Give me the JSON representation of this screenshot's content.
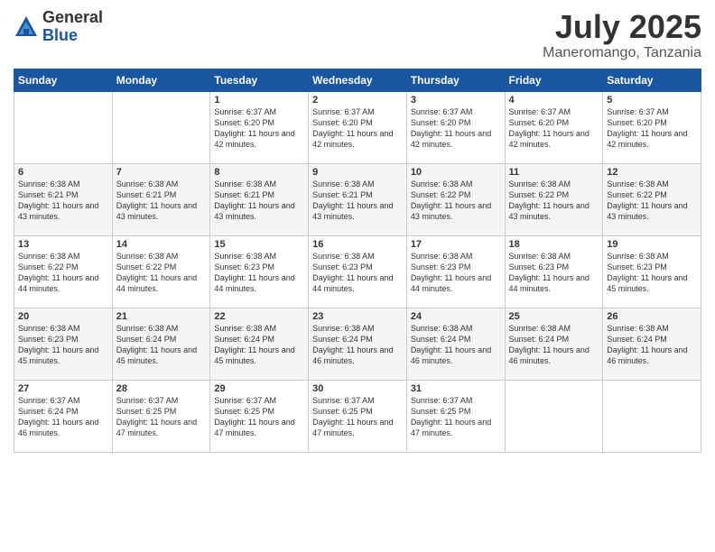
{
  "logo": {
    "general": "General",
    "blue": "Blue"
  },
  "header": {
    "month": "July 2025",
    "location": "Maneromango, Tanzania"
  },
  "weekdays": [
    "Sunday",
    "Monday",
    "Tuesday",
    "Wednesday",
    "Thursday",
    "Friday",
    "Saturday"
  ],
  "weeks": [
    [
      {
        "day": "",
        "info": ""
      },
      {
        "day": "",
        "info": ""
      },
      {
        "day": "1",
        "info": "Sunrise: 6:37 AM\nSunset: 6:20 PM\nDaylight: 11 hours and 42 minutes."
      },
      {
        "day": "2",
        "info": "Sunrise: 6:37 AM\nSunset: 6:20 PM\nDaylight: 11 hours and 42 minutes."
      },
      {
        "day": "3",
        "info": "Sunrise: 6:37 AM\nSunset: 6:20 PM\nDaylight: 11 hours and 42 minutes."
      },
      {
        "day": "4",
        "info": "Sunrise: 6:37 AM\nSunset: 6:20 PM\nDaylight: 11 hours and 42 minutes."
      },
      {
        "day": "5",
        "info": "Sunrise: 6:37 AM\nSunset: 6:20 PM\nDaylight: 11 hours and 42 minutes."
      }
    ],
    [
      {
        "day": "6",
        "info": "Sunrise: 6:38 AM\nSunset: 6:21 PM\nDaylight: 11 hours and 43 minutes."
      },
      {
        "day": "7",
        "info": "Sunrise: 6:38 AM\nSunset: 6:21 PM\nDaylight: 11 hours and 43 minutes."
      },
      {
        "day": "8",
        "info": "Sunrise: 6:38 AM\nSunset: 6:21 PM\nDaylight: 11 hours and 43 minutes."
      },
      {
        "day": "9",
        "info": "Sunrise: 6:38 AM\nSunset: 6:21 PM\nDaylight: 11 hours and 43 minutes."
      },
      {
        "day": "10",
        "info": "Sunrise: 6:38 AM\nSunset: 6:22 PM\nDaylight: 11 hours and 43 minutes."
      },
      {
        "day": "11",
        "info": "Sunrise: 6:38 AM\nSunset: 6:22 PM\nDaylight: 11 hours and 43 minutes."
      },
      {
        "day": "12",
        "info": "Sunrise: 6:38 AM\nSunset: 6:22 PM\nDaylight: 11 hours and 43 minutes."
      }
    ],
    [
      {
        "day": "13",
        "info": "Sunrise: 6:38 AM\nSunset: 6:22 PM\nDaylight: 11 hours and 44 minutes."
      },
      {
        "day": "14",
        "info": "Sunrise: 6:38 AM\nSunset: 6:22 PM\nDaylight: 11 hours and 44 minutes."
      },
      {
        "day": "15",
        "info": "Sunrise: 6:38 AM\nSunset: 6:23 PM\nDaylight: 11 hours and 44 minutes."
      },
      {
        "day": "16",
        "info": "Sunrise: 6:38 AM\nSunset: 6:23 PM\nDaylight: 11 hours and 44 minutes."
      },
      {
        "day": "17",
        "info": "Sunrise: 6:38 AM\nSunset: 6:23 PM\nDaylight: 11 hours and 44 minutes."
      },
      {
        "day": "18",
        "info": "Sunrise: 6:38 AM\nSunset: 6:23 PM\nDaylight: 11 hours and 44 minutes."
      },
      {
        "day": "19",
        "info": "Sunrise: 6:38 AM\nSunset: 6:23 PM\nDaylight: 11 hours and 45 minutes."
      }
    ],
    [
      {
        "day": "20",
        "info": "Sunrise: 6:38 AM\nSunset: 6:23 PM\nDaylight: 11 hours and 45 minutes."
      },
      {
        "day": "21",
        "info": "Sunrise: 6:38 AM\nSunset: 6:24 PM\nDaylight: 11 hours and 45 minutes."
      },
      {
        "day": "22",
        "info": "Sunrise: 6:38 AM\nSunset: 6:24 PM\nDaylight: 11 hours and 45 minutes."
      },
      {
        "day": "23",
        "info": "Sunrise: 6:38 AM\nSunset: 6:24 PM\nDaylight: 11 hours and 46 minutes."
      },
      {
        "day": "24",
        "info": "Sunrise: 6:38 AM\nSunset: 6:24 PM\nDaylight: 11 hours and 46 minutes."
      },
      {
        "day": "25",
        "info": "Sunrise: 6:38 AM\nSunset: 6:24 PM\nDaylight: 11 hours and 46 minutes."
      },
      {
        "day": "26",
        "info": "Sunrise: 6:38 AM\nSunset: 6:24 PM\nDaylight: 11 hours and 46 minutes."
      }
    ],
    [
      {
        "day": "27",
        "info": "Sunrise: 6:37 AM\nSunset: 6:24 PM\nDaylight: 11 hours and 46 minutes."
      },
      {
        "day": "28",
        "info": "Sunrise: 6:37 AM\nSunset: 6:25 PM\nDaylight: 11 hours and 47 minutes."
      },
      {
        "day": "29",
        "info": "Sunrise: 6:37 AM\nSunset: 6:25 PM\nDaylight: 11 hours and 47 minutes."
      },
      {
        "day": "30",
        "info": "Sunrise: 6:37 AM\nSunset: 6:25 PM\nDaylight: 11 hours and 47 minutes."
      },
      {
        "day": "31",
        "info": "Sunrise: 6:37 AM\nSunset: 6:25 PM\nDaylight: 11 hours and 47 minutes."
      },
      {
        "day": "",
        "info": ""
      },
      {
        "day": "",
        "info": ""
      }
    ]
  ]
}
